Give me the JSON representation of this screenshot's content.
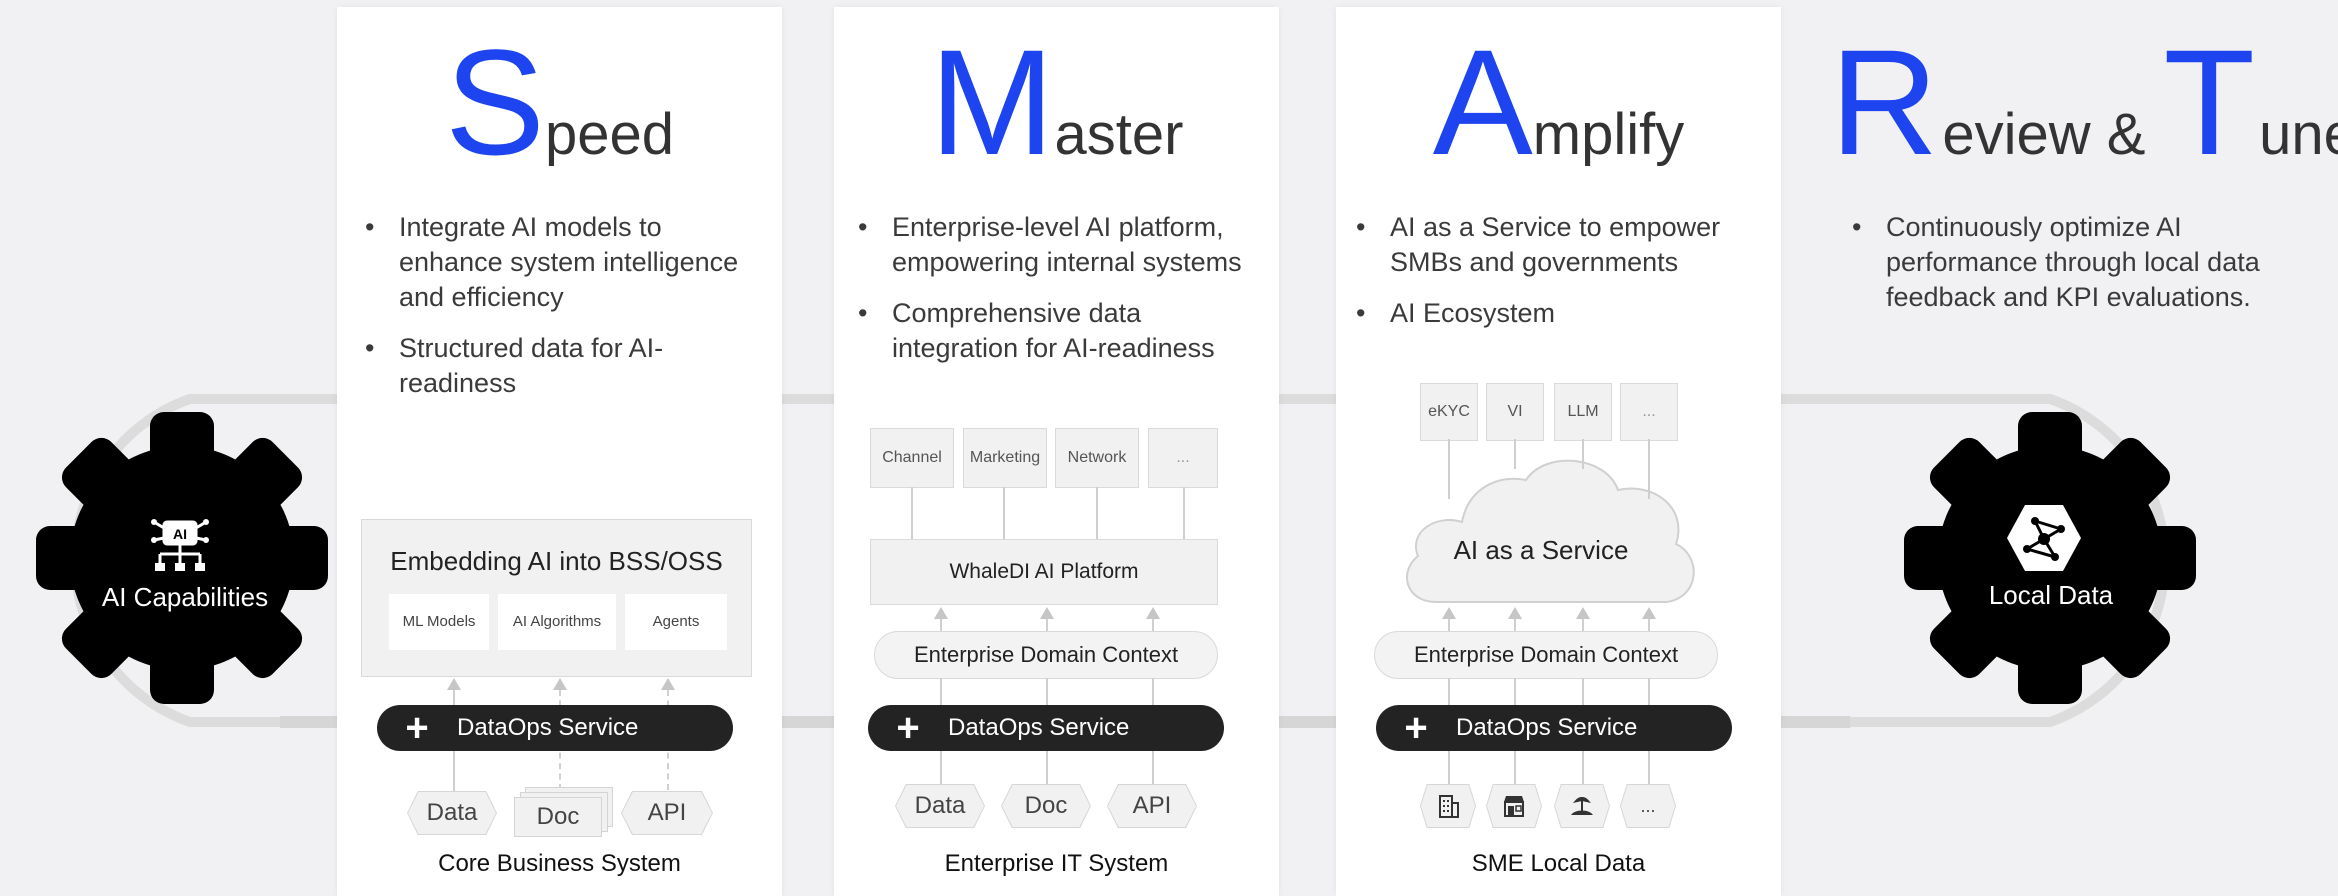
{
  "columns": {
    "speed": {
      "letter": "S",
      "rest": "peed",
      "bullets": [
        "Integrate AI models to enhance system intelligence and efficiency",
        "Structured data for AI-readiness"
      ],
      "panel_title": "Embedding AI into BSS/OSS",
      "panel_items": [
        "ML Models",
        "AI Algorithms",
        "Agents"
      ],
      "ops_label": "DataOps Service",
      "sources": [
        "Data",
        "Doc",
        "API"
      ],
      "caption": "Core Business System"
    },
    "master": {
      "letter": "M",
      "rest": "aster",
      "bullets": [
        "Enterprise-level AI platform, empowering internal systems",
        "Comprehensive data integration for AI-readiness"
      ],
      "top_boxes": [
        "Channel",
        "Marketing",
        "Network",
        "..."
      ],
      "platform": "WhaleDI AI Platform",
      "context": "Enterprise Domain Context",
      "ops_label": "DataOps Service",
      "sources": [
        "Data",
        "Doc",
        "API"
      ],
      "caption": "Enterprise IT System"
    },
    "amplify": {
      "letter": "A",
      "rest": "mplify",
      "bullets": [
        "AI as a Service to empower SMBs and governments",
        "AI Ecosystem"
      ],
      "top_boxes": [
        "eKYC",
        "VI",
        "LLM",
        "..."
      ],
      "cloud": "AI as a Service",
      "context": "Enterprise Domain Context",
      "ops_label": "DataOps Service",
      "sources": [
        "building-icon",
        "shop-icon",
        "farm-icon",
        "..."
      ],
      "caption": "SME Local Data"
    },
    "review": {
      "letter1": "R",
      "rest1": "eview &",
      "letter2": "T",
      "rest2": "une",
      "bullets": [
        "Continuously optimize AI performance through local data feedback and KPI evaluations."
      ]
    }
  },
  "gears": {
    "left": "AI Capabilities",
    "right": "Local Data"
  },
  "colors": {
    "accent": "#1e44f0",
    "dark": "#000000",
    "ops": "#232323"
  }
}
